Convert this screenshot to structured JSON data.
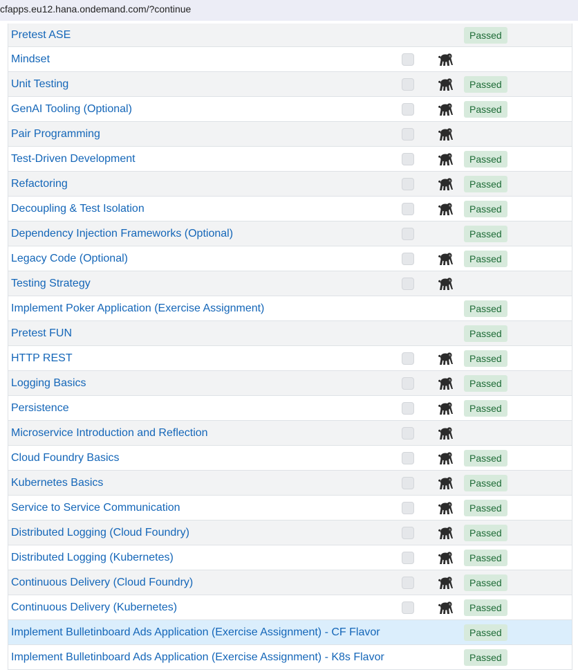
{
  "browser": {
    "url": "cfapps.eu12.hana.ondemand.com/?continue"
  },
  "status_label": "Passed",
  "rows": [
    {
      "title": "Pretest ASE",
      "checkbox": false,
      "gorilla": false,
      "passed": true
    },
    {
      "title": "Mindset",
      "checkbox": true,
      "gorilla": true,
      "passed": false
    },
    {
      "title": "Unit Testing",
      "checkbox": true,
      "gorilla": true,
      "passed": true
    },
    {
      "title": "GenAI Tooling (Optional)",
      "checkbox": true,
      "gorilla": true,
      "passed": true
    },
    {
      "title": "Pair Programming",
      "checkbox": true,
      "gorilla": true,
      "passed": false
    },
    {
      "title": "Test-Driven Development",
      "checkbox": true,
      "gorilla": true,
      "passed": true
    },
    {
      "title": "Refactoring",
      "checkbox": true,
      "gorilla": true,
      "passed": true
    },
    {
      "title": "Decoupling & Test Isolation",
      "checkbox": true,
      "gorilla": true,
      "passed": true
    },
    {
      "title": "Dependency Injection Frameworks (Optional)",
      "checkbox": true,
      "gorilla": false,
      "passed": true
    },
    {
      "title": "Legacy Code (Optional)",
      "checkbox": true,
      "gorilla": true,
      "passed": true
    },
    {
      "title": "Testing Strategy",
      "checkbox": true,
      "gorilla": true,
      "passed": false
    },
    {
      "title": "Implement Poker Application (Exercise Assignment)",
      "checkbox": false,
      "gorilla": false,
      "passed": true
    },
    {
      "title": "Pretest FUN",
      "checkbox": false,
      "gorilla": false,
      "passed": true
    },
    {
      "title": "HTTP REST",
      "checkbox": true,
      "gorilla": true,
      "passed": true
    },
    {
      "title": "Logging Basics",
      "checkbox": true,
      "gorilla": true,
      "passed": true
    },
    {
      "title": "Persistence",
      "checkbox": true,
      "gorilla": true,
      "passed": true
    },
    {
      "title": "Microservice Introduction and Reflection",
      "checkbox": true,
      "gorilla": true,
      "passed": false
    },
    {
      "title": "Cloud Foundry Basics",
      "checkbox": true,
      "gorilla": true,
      "passed": true
    },
    {
      "title": "Kubernetes Basics",
      "checkbox": true,
      "gorilla": true,
      "passed": true
    },
    {
      "title": "Service to Service Communication",
      "checkbox": true,
      "gorilla": true,
      "passed": true
    },
    {
      "title": "Distributed Logging (Cloud Foundry)",
      "checkbox": true,
      "gorilla": true,
      "passed": true
    },
    {
      "title": "Distributed Logging (Kubernetes)",
      "checkbox": true,
      "gorilla": true,
      "passed": true
    },
    {
      "title": "Continuous Delivery (Cloud Foundry)",
      "checkbox": true,
      "gorilla": true,
      "passed": true
    },
    {
      "title": "Continuous Delivery (Kubernetes)",
      "checkbox": true,
      "gorilla": true,
      "passed": true
    },
    {
      "title": "Implement Bulletinboard Ads Application (Exercise Assignment) - CF Flavor",
      "checkbox": false,
      "gorilla": false,
      "passed": true,
      "highlighted": true
    },
    {
      "title": "Implement Bulletinboard Ads Application (Exercise Assignment) - K8s Flavor",
      "checkbox": false,
      "gorilla": false,
      "passed": true
    }
  ],
  "colors": {
    "link": "#1466b8",
    "badge_bg": "#d7eadc",
    "badge_text": "#1d6b36",
    "row_stripe": "#f2f3f4",
    "row_highlight": "#dbeefc"
  },
  "icons": {
    "row_icon": "gorilla-icon"
  }
}
